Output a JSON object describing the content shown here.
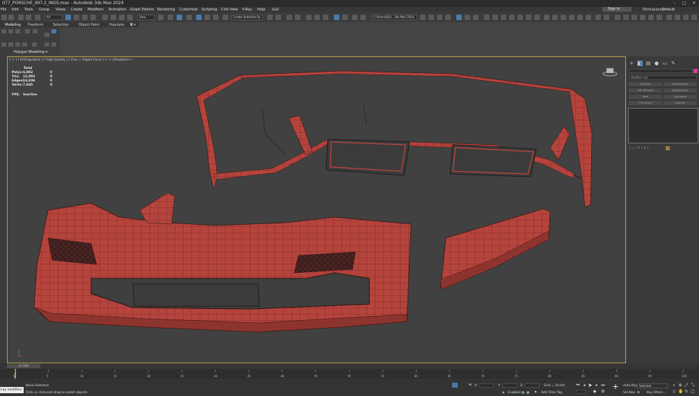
{
  "window": {
    "title": "GT7_PORSCHE_997.2_INGS.max - Autodesk 3ds Max 2024",
    "controls": [
      "–",
      "□",
      "✕"
    ]
  },
  "menu": {
    "items": [
      "File",
      "Edit",
      "Tools",
      "Group",
      "Views",
      "Create",
      "Modifiers",
      "Animation",
      "Graph Editors",
      "Rendering",
      "Customize",
      "Scripting",
      "Civil View",
      "V-Ray",
      "Help",
      "Go2"
    ],
    "sign_in": "Sign In",
    "workspaces_label": "Workspaces:",
    "workspaces_value": "Default"
  },
  "toolbar": {
    "filter_select": "All",
    "view_select": "View",
    "selection_set": "Create Selection Se",
    "path_select": "C:\\Users\\Q01...3ds Max 2024"
  },
  "ribbon": {
    "tabs": [
      "Modeling",
      "Freeform",
      "Selection",
      "Object Paint",
      "Populate"
    ],
    "active_tab": "Modeling",
    "panel_label": "Polygon Modeling ▾"
  },
  "viewport": {
    "label": "[ + ] [ Orthographic ] [ High Quality ] [ Clay + Edged Faces ]  ▽  <<Disabled>>",
    "stats": {
      "header": "Total",
      "rows": [
        {
          "label": "Polys:",
          "total": "6,982",
          "sel": "0"
        },
        {
          "label": "Tris:",
          "total": "12,992",
          "sel": "0"
        },
        {
          "label": "Edges:",
          "total": "14,836",
          "sel": "0"
        },
        {
          "label": "Verts:",
          "total": "7,045",
          "sel": "0"
        }
      ],
      "fps_label": "FPS:",
      "fps_value": "Inactive"
    }
  },
  "command_panel": {
    "modifier_list": "Modifier List",
    "buttons": [
      "Edit Poly",
      "MeshSmooth",
      "Edit Normals",
      "TurboSmooth",
      "Shell",
      "Symmetry",
      "FFD Select",
      "Chamfer"
    ]
  },
  "time": {
    "frame_slider": "0 / 100",
    "ticks": [
      "0",
      "5",
      "10",
      "15",
      "20",
      "25",
      "30",
      "35",
      "40",
      "45",
      "50",
      "55",
      "60",
      "65",
      "70",
      "75",
      "80",
      "85",
      "90",
      "95",
      "100"
    ]
  },
  "status": {
    "maxscript": "rray modifiers",
    "selection": "None Selected",
    "prompt": "Click or click-and-drag to select objects",
    "x_label": "X:",
    "y_label": "Y:",
    "z_label": "Z:",
    "grid": "Grid = 10.0m",
    "enabled": "Enabled:",
    "add_time_tag": "Add Time Tag",
    "auto_key": "Auto Key",
    "set_key": "Set Key",
    "selected": "Selected",
    "key_filters": "Key Filters..."
  },
  "colors": {
    "model_red": "#b5443d",
    "viewport_border": "#b9a04a",
    "active_blue": "#4a7aa8"
  }
}
